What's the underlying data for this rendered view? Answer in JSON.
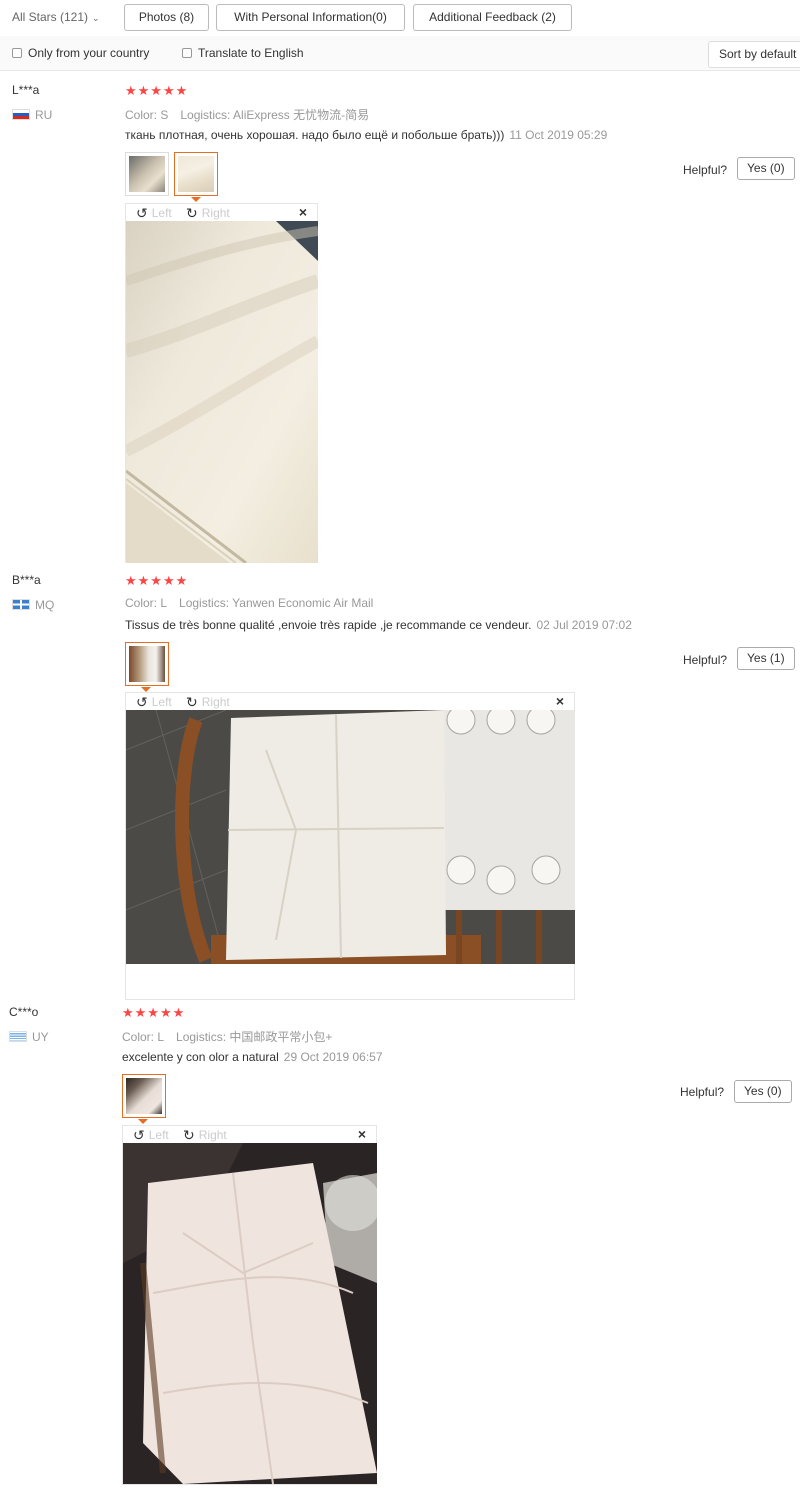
{
  "filters": {
    "all_stars": "All Stars (121)",
    "photos": "Photos (8)",
    "personal": "With Personal Information(0)",
    "additional": "Additional Feedback (2)"
  },
  "options": {
    "only_country": "Only from your country",
    "translate": "Translate to English",
    "sort": "Sort by default"
  },
  "reviews": [
    {
      "user": "L***a",
      "country": "RU",
      "stars": "★★★★★",
      "color": "Color: S",
      "logistics": "Logistics: AliExpress 无忧物流-简易",
      "text": "ткань плотная, очень хорошая. надо было ещё и побольше брать)))",
      "date": "11 Oct 2019 05:29",
      "helpful": "Helpful?",
      "yes": "Yes (0)"
    },
    {
      "user": "B***a",
      "country": "MQ",
      "stars": "★★★★★",
      "color": "Color: L",
      "logistics": "Logistics: Yanwen Economic Air Mail",
      "text": "Tissus de très bonne qualité ,envoie très rapide ,je recommande ce vendeur.",
      "date": "02 Jul 2019 07:02",
      "helpful": "Helpful?",
      "yes": "Yes (1)"
    },
    {
      "user": "C***o",
      "country": "UY",
      "stars": "★★★★★",
      "color": "Color: L",
      "logistics": "Logistics: 中国邮政平常小包+",
      "text": "excelente y con olor a natural",
      "date": "29 Oct 2019 06:57",
      "helpful": "Helpful?",
      "yes": "Yes (0)"
    }
  ],
  "viewer": {
    "left": "Left",
    "right": "Right",
    "close": "×",
    "rotate_left_icon": "rotate-left-icon",
    "rotate_right_icon": "rotate-right-icon"
  },
  "colors": {
    "star": "#ff4444",
    "active_thumb": "#e66e22"
  }
}
